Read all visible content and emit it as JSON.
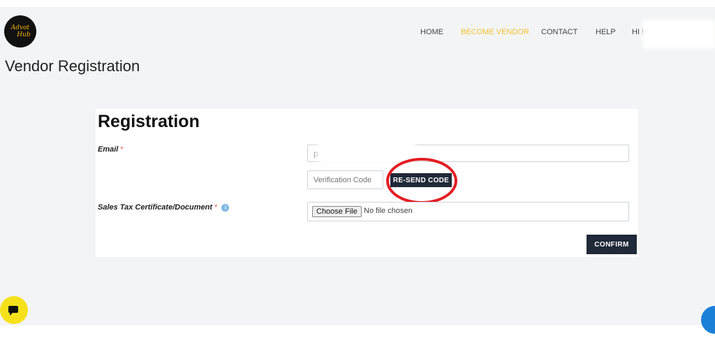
{
  "logo": {
    "line1": "Advot",
    "line2": "Hub"
  },
  "nav": {
    "items": [
      "HOME",
      "BECOME VENDOR",
      "CONTACT",
      "HELP",
      "HI !"
    ],
    "active_color": "#f2c230"
  },
  "page_title": "Vendor Registration",
  "form": {
    "title": "Registration",
    "email_label": "Email",
    "required_mark": "*",
    "email_value": "p",
    "verification_placeholder": "Verification Code",
    "resend_label": "RE-SEND CODE",
    "tax_label": "Sales Tax Certificate/Document",
    "info_icon": "i",
    "choose_file_label": "Choose File",
    "no_file_text": "No file chosen",
    "confirm_label": "CONFIRM"
  },
  "colors": {
    "button_dark": "#1f2937",
    "highlight_circle": "#e31e24",
    "chat_button": "#f5e11a"
  }
}
